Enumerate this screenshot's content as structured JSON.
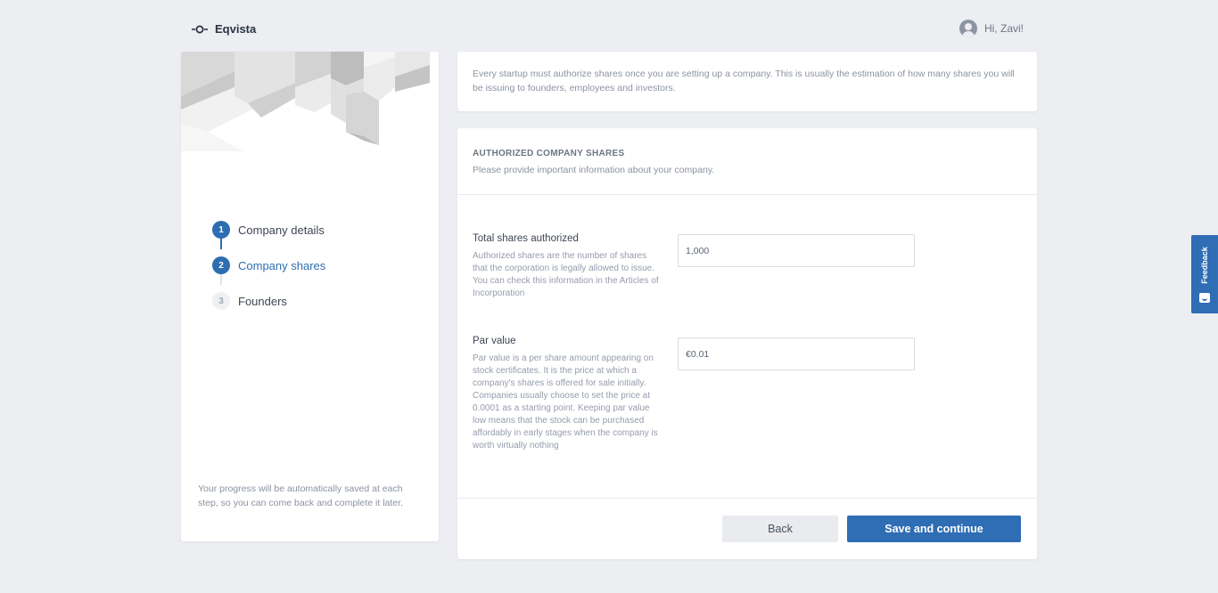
{
  "header": {
    "brand": "Eqvista",
    "greeting": "Hi, Zavi!"
  },
  "steps": [
    {
      "number": "1",
      "label": "Company details",
      "state": "done"
    },
    {
      "number": "2",
      "label": "Company shares",
      "state": "active"
    },
    {
      "number": "3",
      "label": "Founders",
      "state": "todo"
    }
  ],
  "side_note": "Your progress will be automatically saved at each step, so you can come back and complete it later.",
  "intro": "Every startup must authorize shares once you are setting up a company. This is usually the estimation of how many shares you will be issuing to founders, employees and investors.",
  "form": {
    "title": "AUTHORIZED COMPANY SHARES",
    "subtitle": "Please provide important information about your company.",
    "fields": [
      {
        "label": "Total shares authorized",
        "help": "Authorized shares are the number of shares that the corporation is legally allowed to issue. You can check this information in the Articles of Incorporation",
        "value": "1,000"
      },
      {
        "label": "Par value",
        "help": "Par value is a per share amount appearing on stock certificates. It is the price at which a company's shares is offered for sale initially. Companies usually choose to set the price at 0.0001 as a starting point. Keeping par value low means that the stock can be purchased affordably in early stages when the company is worth virtually nothing",
        "value": "€0.01"
      }
    ],
    "back_label": "Back",
    "save_label": "Save and continue"
  },
  "feedback_label": "Feedback",
  "colors": {
    "accent": "#2f6db4",
    "background": "#eceef2"
  }
}
